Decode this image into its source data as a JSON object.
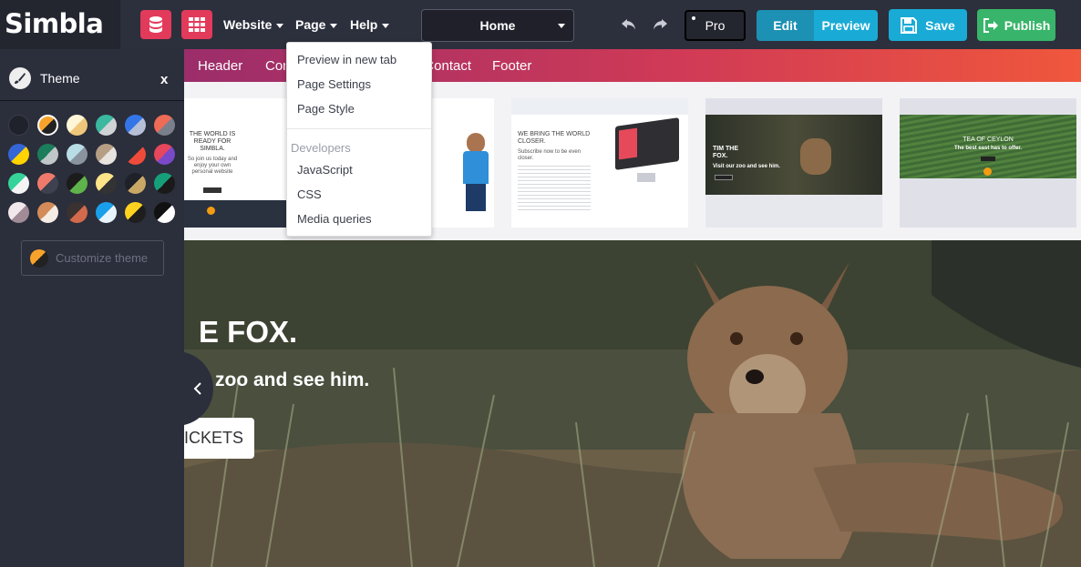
{
  "app": {
    "logo": "Simbla"
  },
  "topbar": {
    "menus": [
      "Website",
      "Page",
      "Help"
    ],
    "page_select": "Home",
    "pro_label": "Pro",
    "edit_label": "Edit",
    "preview_label": "Preview",
    "save_label": "Save",
    "publish_label": "Publish"
  },
  "sidebar": {
    "title": "Theme",
    "close": "x",
    "customize_label": "Customize theme"
  },
  "sections": [
    "Header",
    "Cont",
    "Contact",
    "Footer"
  ],
  "page_menu": {
    "items": [
      "Preview in new tab",
      "Page Settings",
      "Page Style"
    ],
    "developers_heading": "Developers",
    "dev_items": [
      "JavaScript",
      "CSS",
      "Media queries"
    ]
  },
  "thumbnails": [
    {
      "title": "THE WORLD IS READY FOR SIMBLA.",
      "sub": "So join us today and enjoy your own personal website"
    },
    {
      "title": "WE BRING THE WORLD CLOSER.",
      "sub": "Subscribe now to be even closer."
    },
    {
      "title": "TIM THE FOX.",
      "sub": "Visit our zoo and see him."
    },
    {
      "title": "TEA OF CEYLON",
      "sub": "The best east has to offer."
    }
  ],
  "hero": {
    "title": "E FOX.",
    "subtitle": "r zoo and see him.",
    "button": "ICKETS"
  },
  "colors": {
    "accent_red": "#e23a5a",
    "edit_blue": "#1d91b4",
    "preview_blue": "#19abd6",
    "publish_green": "#38b56a"
  }
}
